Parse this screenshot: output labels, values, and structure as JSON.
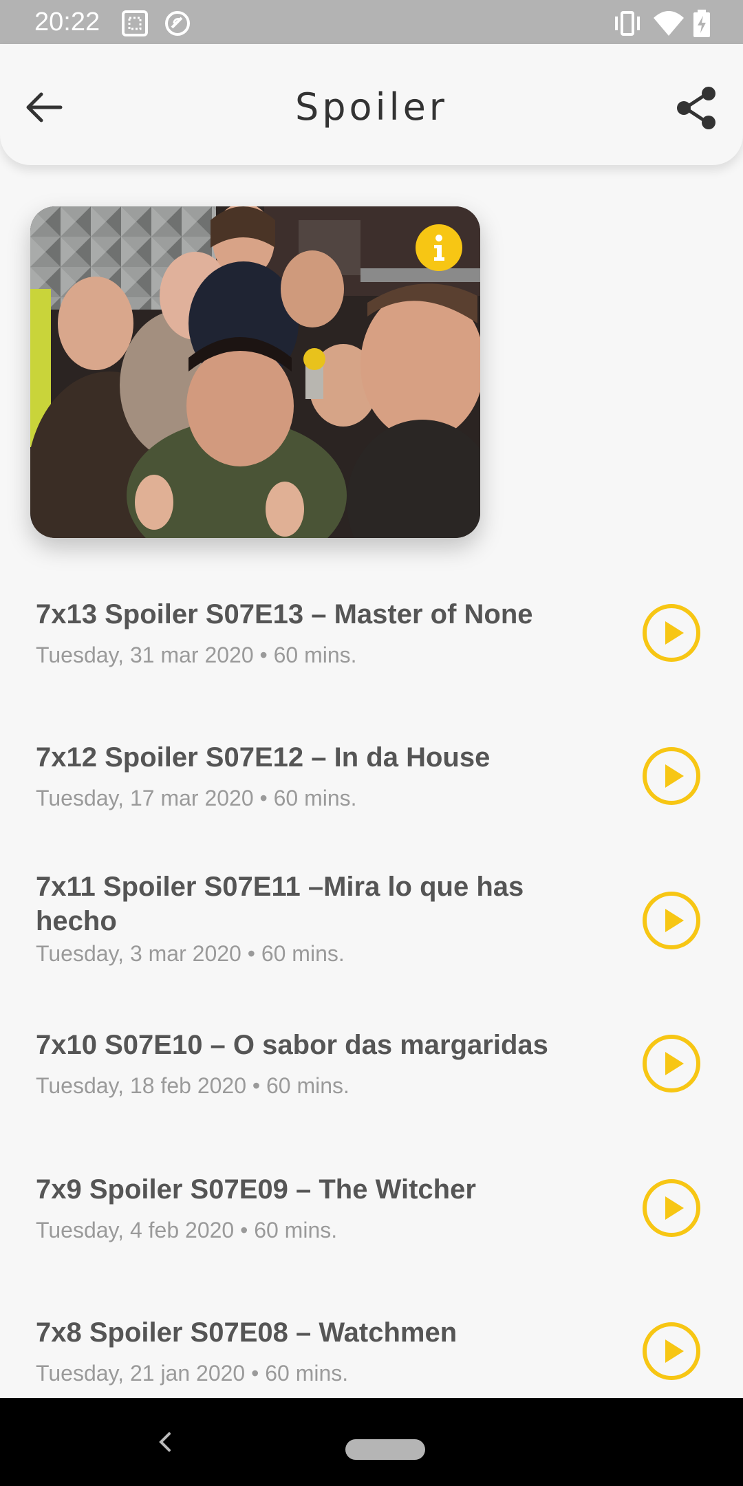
{
  "status_bar": {
    "time": "20:22",
    "icons": [
      "screenshot-icon",
      "sync-icon",
      "vibrate-icon",
      "wifi-icon",
      "battery-charging-icon"
    ]
  },
  "app_bar": {
    "title": "Spoiler",
    "back_icon": "arrow-left-icon",
    "share_icon": "share-icon"
  },
  "cover": {
    "image": "group-photo-podcast-hosts",
    "badge_icon": "info-icon",
    "accent_color": "#F7C614"
  },
  "episodes": [
    {
      "title": "7x13 Spoiler S07E13 – Master of None",
      "meta": "Tuesday, 31 mar 2020 • 60 mins."
    },
    {
      "title": "7x12 Spoiler S07E12 – In da House",
      "meta": "Tuesday, 17 mar 2020 • 60 mins."
    },
    {
      "title": "7x11 Spoiler S07E11 –Mira lo que has hecho",
      "meta": "Tuesday, 3 mar 2020 • 60 mins."
    },
    {
      "title": "7x10 S07E10 – O sabor das margaridas",
      "meta": "Tuesday, 18 feb 2020 • 60 mins."
    },
    {
      "title": "7x9 Spoiler S07E09 – The Witcher",
      "meta": "Tuesday, 4 feb 2020 • 60 mins."
    },
    {
      "title": "7x8 Spoiler S07E08 – Watchmen",
      "meta": "Tuesday, 21 jan 2020 • 60 mins."
    }
  ],
  "play_icon": "play-circle-icon",
  "nav_bar": {
    "back_icon": "nav-back-icon",
    "home_icon": "nav-home-pill"
  }
}
